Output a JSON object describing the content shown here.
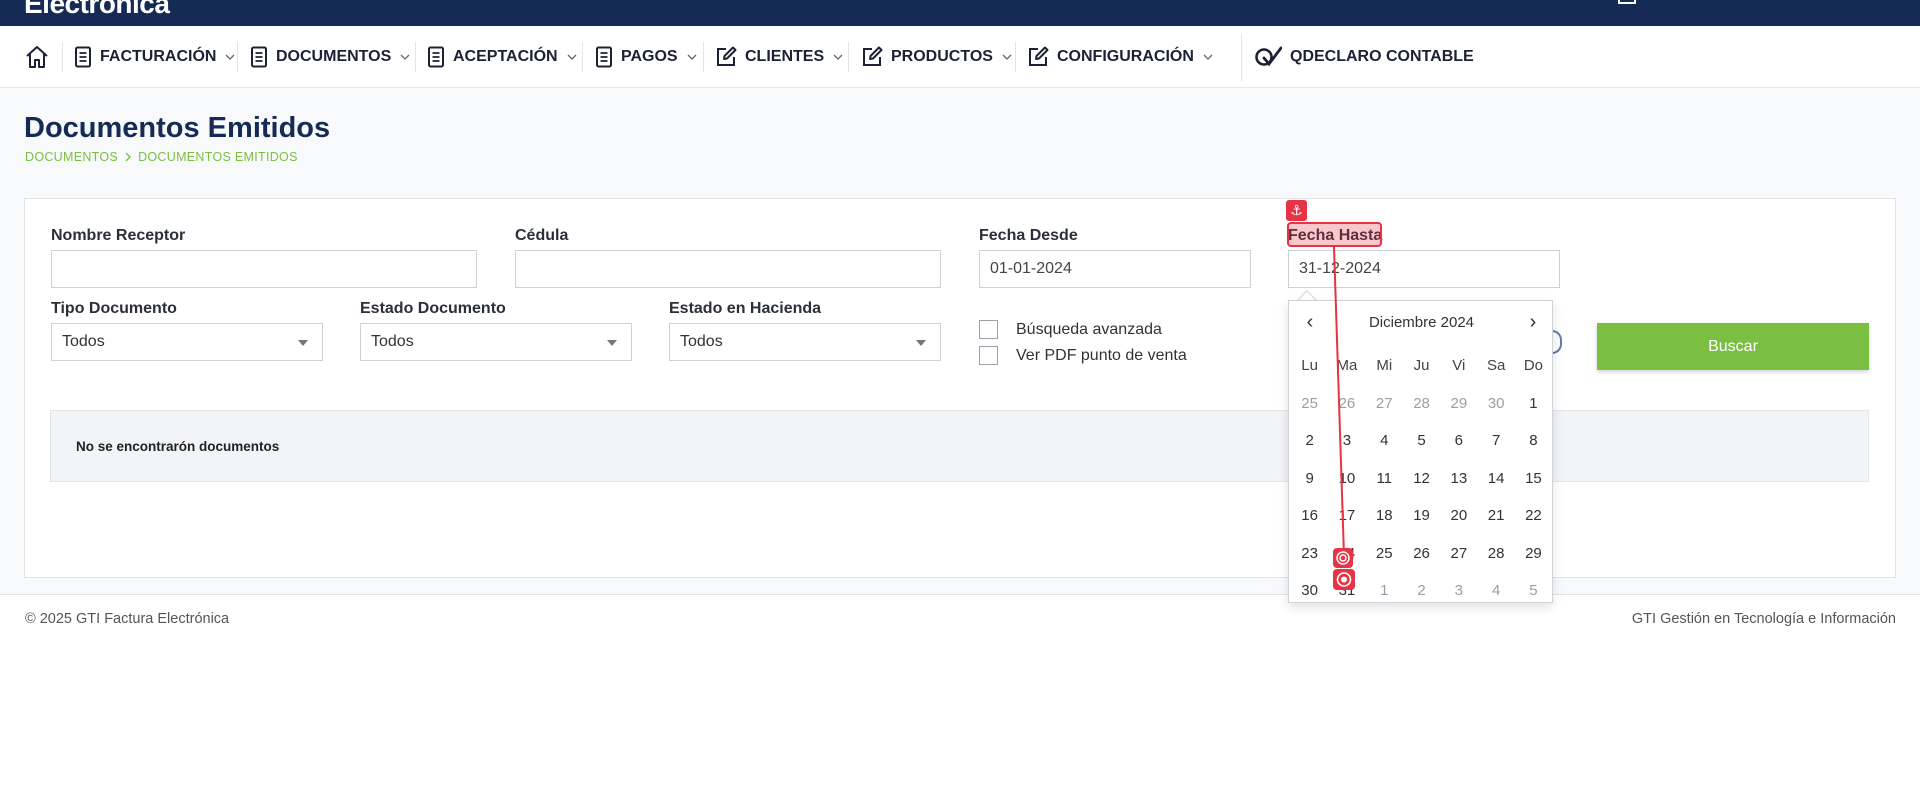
{
  "brand": {
    "name": "Electrónica"
  },
  "nav": {
    "items": [
      {
        "label": "FACTURACIÓN",
        "icon": "document-icon",
        "dropdown": true
      },
      {
        "label": "DOCUMENTOS",
        "icon": "document-icon",
        "dropdown": true
      },
      {
        "label": "ACEPTACIÓN",
        "icon": "document-icon",
        "dropdown": true
      },
      {
        "label": "PAGOS",
        "icon": "document-icon",
        "dropdown": true
      },
      {
        "label": "CLIENTES",
        "icon": "edit-icon",
        "dropdown": true
      },
      {
        "label": "PRODUCTOS",
        "icon": "edit-icon",
        "dropdown": true
      },
      {
        "label": "CONFIGURACIÓN",
        "icon": "edit-icon",
        "dropdown": true
      },
      {
        "label": "QDECLARO CONTABLE",
        "icon": "qdeclaro-logo-icon",
        "dropdown": false
      }
    ]
  },
  "page": {
    "title": "Documentos Emitidos",
    "breadcrumb": [
      "DOCUMENTOS",
      "DOCUMENTOS EMITIDOS"
    ]
  },
  "form": {
    "nombre_receptor": {
      "label": "Nombre Receptor",
      "value": ""
    },
    "cedula": {
      "label": "Cédula",
      "value": ""
    },
    "fecha_desde": {
      "label": "Fecha Desde",
      "value": "01-01-2024"
    },
    "fecha_hasta": {
      "label": "Fecha Hasta",
      "value": "31-12-2024"
    },
    "tipo_documento": {
      "label": "Tipo Documento",
      "value": "Todos"
    },
    "estado_documento": {
      "label": "Estado Documento",
      "value": "Todos"
    },
    "estado_hacienda": {
      "label": "Estado en Hacienda",
      "value": "Todos"
    },
    "busqueda_avanzada": {
      "label": "Búsqueda avanzada",
      "checked": false
    },
    "ver_pdf": {
      "label": "Ver PDF punto de venta",
      "checked": false
    },
    "buscar_label": "Buscar"
  },
  "results": {
    "empty_message": "No se encontrarón documentos"
  },
  "datepicker": {
    "month_label": "Diciembre 2024",
    "prev": "‹",
    "next": "›",
    "weekdays": [
      "Lu",
      "Ma",
      "Mi",
      "Ju",
      "Vi",
      "Sa",
      "Do"
    ],
    "weeks": [
      [
        {
          "d": "25",
          "m": true
        },
        {
          "d": "26",
          "m": true
        },
        {
          "d": "27",
          "m": true
        },
        {
          "d": "28",
          "m": true
        },
        {
          "d": "29",
          "m": true
        },
        {
          "d": "30",
          "m": true
        },
        {
          "d": "1",
          "m": false
        }
      ],
      [
        {
          "d": "2",
          "m": false
        },
        {
          "d": "3",
          "m": false
        },
        {
          "d": "4",
          "m": false
        },
        {
          "d": "5",
          "m": false
        },
        {
          "d": "6",
          "m": false
        },
        {
          "d": "7",
          "m": false
        },
        {
          "d": "8",
          "m": false
        }
      ],
      [
        {
          "d": "9",
          "m": false
        },
        {
          "d": "10",
          "m": false
        },
        {
          "d": "11",
          "m": false
        },
        {
          "d": "12",
          "m": false
        },
        {
          "d": "13",
          "m": false
        },
        {
          "d": "14",
          "m": false
        },
        {
          "d": "15",
          "m": false
        }
      ],
      [
        {
          "d": "16",
          "m": false
        },
        {
          "d": "17",
          "m": false
        },
        {
          "d": "18",
          "m": false
        },
        {
          "d": "19",
          "m": false
        },
        {
          "d": "20",
          "m": false
        },
        {
          "d": "21",
          "m": false
        },
        {
          "d": "22",
          "m": false
        }
      ],
      [
        {
          "d": "23",
          "m": false
        },
        {
          "d": "24",
          "m": false
        },
        {
          "d": "25",
          "m": false
        },
        {
          "d": "26",
          "m": false
        },
        {
          "d": "27",
          "m": false
        },
        {
          "d": "28",
          "m": false
        },
        {
          "d": "29",
          "m": false
        }
      ],
      [
        {
          "d": "30",
          "m": false
        },
        {
          "d": "31",
          "m": false
        },
        {
          "d": "1",
          "m": true
        },
        {
          "d": "2",
          "m": true
        },
        {
          "d": "3",
          "m": true
        },
        {
          "d": "4",
          "m": true
        },
        {
          "d": "5",
          "m": true
        }
      ]
    ]
  },
  "footer": {
    "left": "© 2025 GTI Factura Electrónica",
    "right": "GTI Gestión en Tecnología e Información"
  },
  "colors": {
    "navy": "#152a54",
    "accent_green": "#7bbf42",
    "annotation_red": "#e63345"
  }
}
